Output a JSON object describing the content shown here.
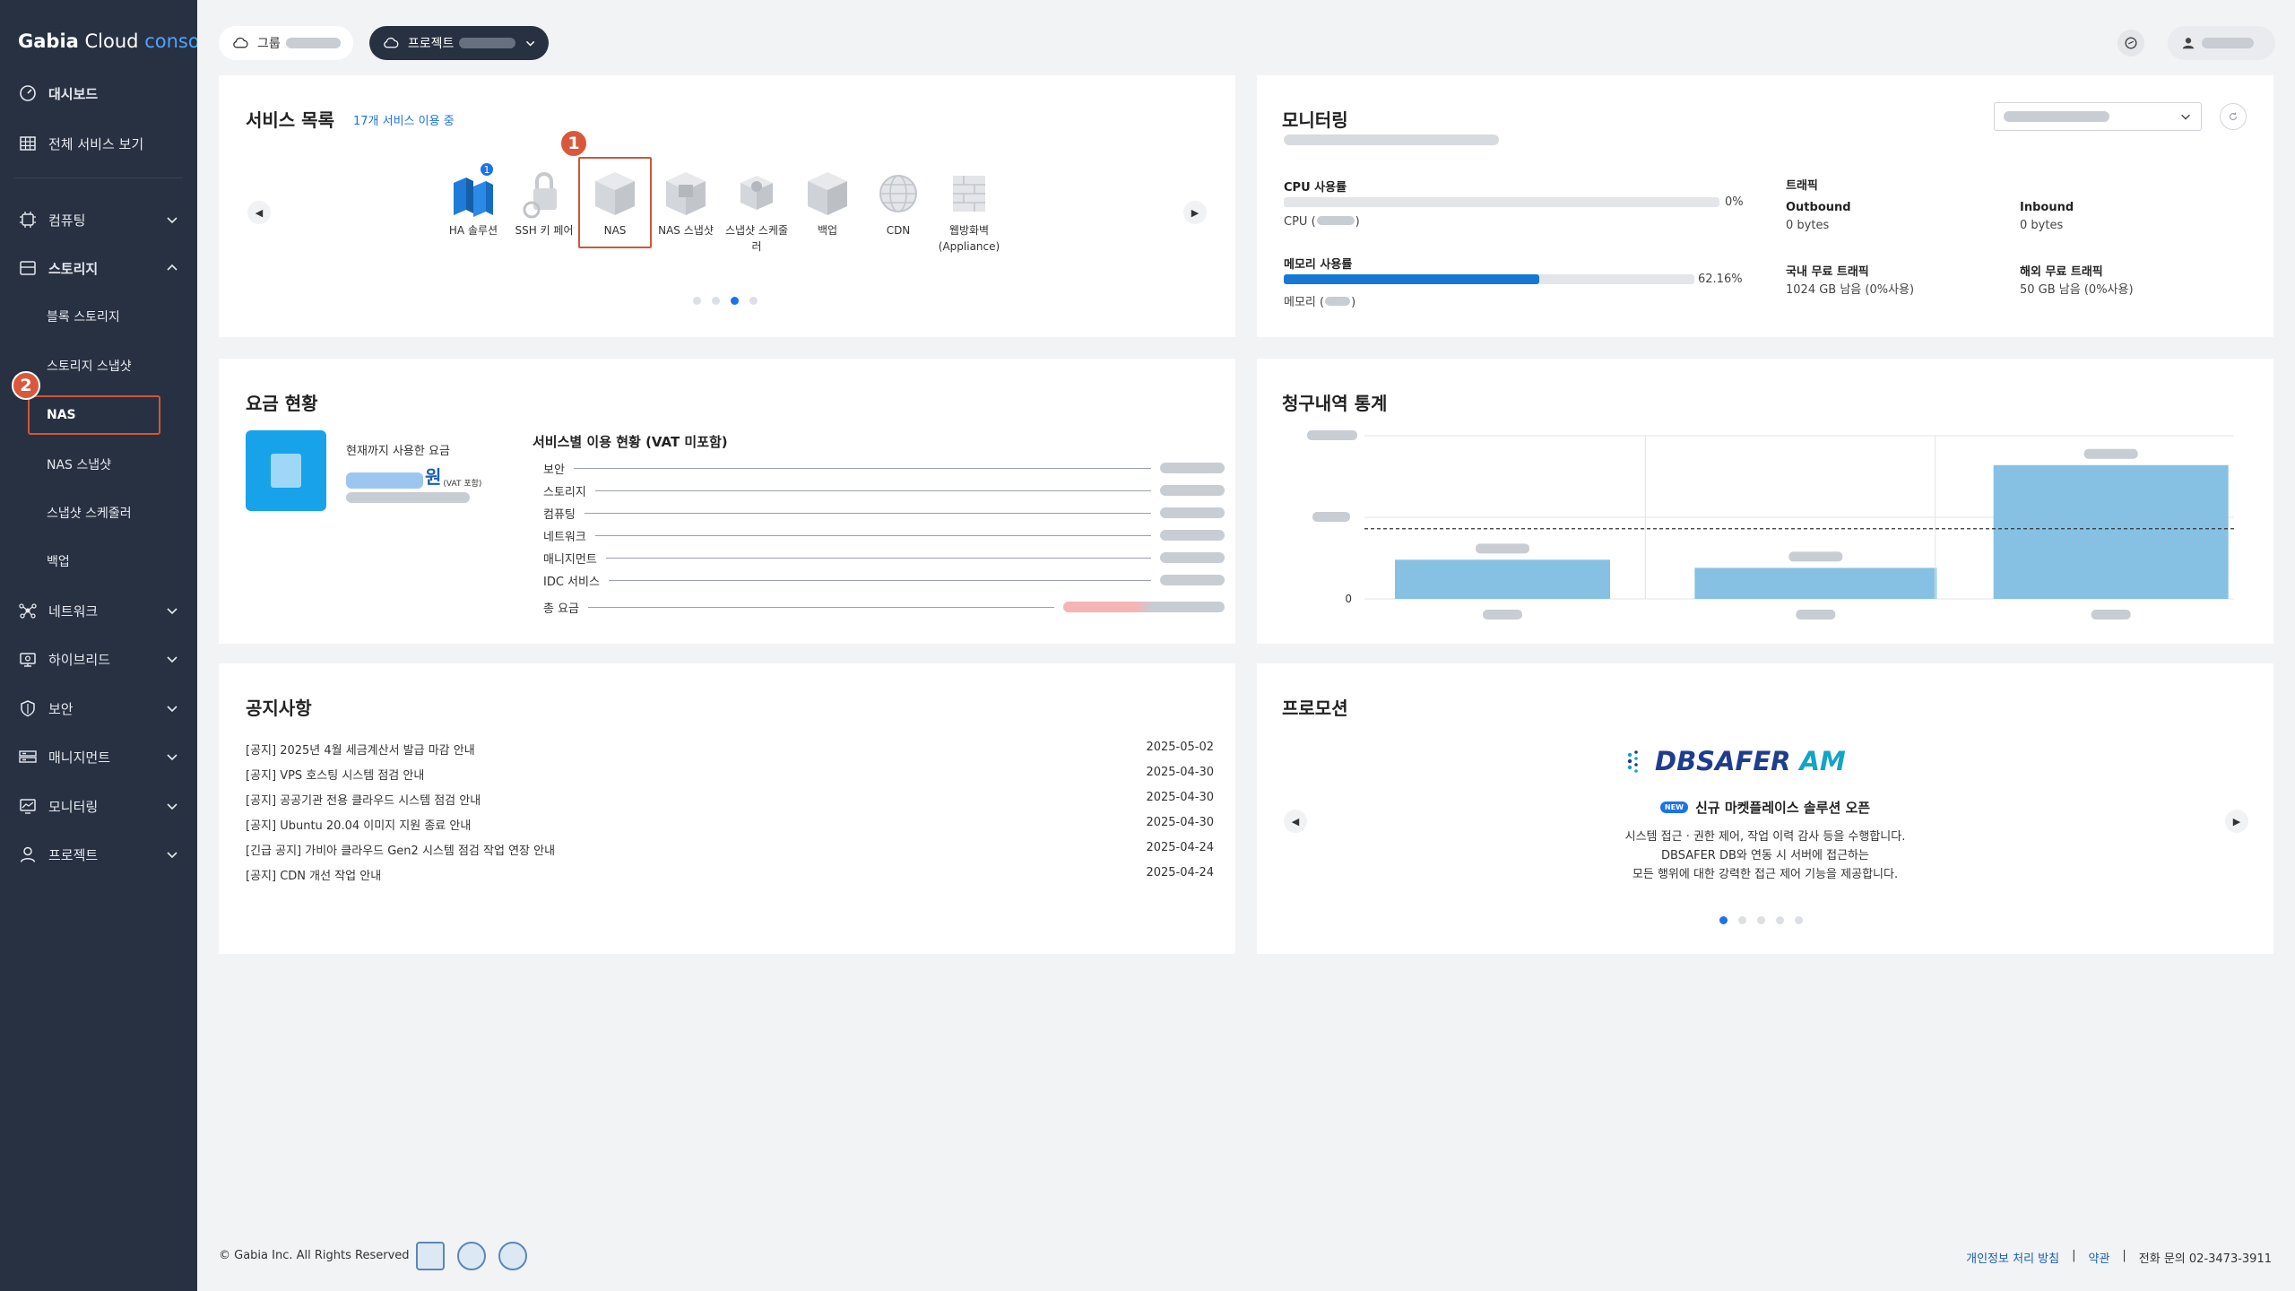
{
  "brand": {
    "name": "Gabia",
    "cloud": "Cloud",
    "console": "console"
  },
  "topbar": {
    "group_label": "그룹",
    "project_label": "프로젝트"
  },
  "sidebar": {
    "top_items": [
      {
        "label": "대시보드",
        "icon": "dashboard-icon"
      },
      {
        "label": "전체 서비스 보기",
        "icon": "grid-icon"
      }
    ],
    "sections": [
      {
        "label": "컴퓨팅",
        "icon": "cpu-icon",
        "expanded": false
      },
      {
        "label": "스토리지",
        "icon": "storage-icon",
        "expanded": true
      },
      {
        "label": "네트워크",
        "icon": "network-icon",
        "expanded": false
      },
      {
        "label": "하이브리드",
        "icon": "hybrid-icon",
        "expanded": false
      },
      {
        "label": "보안",
        "icon": "shield-icon",
        "expanded": false
      },
      {
        "label": "매니지먼트",
        "icon": "management-icon",
        "expanded": false
      },
      {
        "label": "모니터링",
        "icon": "monitor-icon",
        "expanded": false
      },
      {
        "label": "프로젝트",
        "icon": "user-icon",
        "expanded": false
      }
    ],
    "storage_sub": [
      "블록 스토리지",
      "스토리지 스냅샷",
      "NAS",
      "NAS 스냅샷",
      "스냅샷 스케줄러",
      "백업"
    ],
    "active_item": "NAS"
  },
  "markers": [
    "1",
    "2"
  ],
  "services": {
    "title": "서비스 목록",
    "count_text": "17개 서비스 이용 중",
    "items": [
      {
        "name": "HA 솔루션",
        "badge": "1"
      },
      {
        "name": "SSH 키 페어"
      },
      {
        "name": "NAS"
      },
      {
        "name": "NAS 스냅샷"
      },
      {
        "name": "스냅샷 스케줄러"
      },
      {
        "name": "백업"
      },
      {
        "name": "CDN"
      },
      {
        "name": "웹방화벽 (Appliance)"
      }
    ],
    "page_count": 4,
    "current_page": 3
  },
  "monitoring": {
    "title": "모니터링",
    "cpu_label": "CPU 사용률",
    "cpu_percent_text": "0%",
    "cpu_percent": 0,
    "cpu_caption": "CPU (",
    "cpu_caption_end": ")",
    "mem_label": "메모리 사용률",
    "mem_percent_text": "62.16%",
    "mem_percent": 62.16,
    "mem_caption": "메모리 (",
    "mem_caption_end": ")",
    "traffic_title": "트래픽",
    "outbound_label": "Outbound",
    "outbound_value": "0 bytes",
    "inbound_label": "Inbound",
    "inbound_value": "0 bytes",
    "domestic_label": "국내 무료 트래픽",
    "domestic_value": "1024 GB 남음 (0%사용)",
    "overseas_label": "해외 무료 트래픽",
    "overseas_value": "50 GB 남음 (0%사용)"
  },
  "billing": {
    "title": "요금 현황",
    "used_label": "현재까지 사용한 요금",
    "currency": "원",
    "vat_note": "(VAT 포함)",
    "breakdown_title": "서비스별 이용 현황 (VAT 미포함)",
    "rows": [
      "보안",
      "스토리지",
      "컴퓨팅",
      "네트워크",
      "매니지먼트",
      "IDC 서비스"
    ],
    "total_label": "총 요금"
  },
  "billing_stats": {
    "title": "청구내역 통계",
    "y_zero_label": "0"
  },
  "chart_data": {
    "type": "bar",
    "title": "청구내역 통계",
    "categories": [
      "",
      "",
      ""
    ],
    "values": [
      0.24,
      0.19,
      0.82
    ],
    "grid": true,
    "reference_line": 0.43
  },
  "notices": {
    "title": "공지사항",
    "items": [
      {
        "title": "[공지] 2025년 4월 세금계산서 발급 마감 안내",
        "date": "2025-05-02"
      },
      {
        "title": "[공지] VPS 호스팅 시스템 점검 안내",
        "date": "2025-04-30"
      },
      {
        "title": "[공지] 공공기관 전용 클라우드 시스템 점검 안내",
        "date": "2025-04-30"
      },
      {
        "title": "[공지] Ubuntu 20.04 이미지 지원 종료 안내",
        "date": "2025-04-30"
      },
      {
        "title": "[긴급 공지] 가비아 클라우드 Gen2 시스템 점검 작업 연장 안내",
        "date": "2025-04-24"
      },
      {
        "title": "[공지] CDN 개선 작업 안내",
        "date": "2025-04-24"
      }
    ]
  },
  "promotion": {
    "title": "프로모션",
    "logo_main": "DBSAFER",
    "logo_am": "AM",
    "new_badge": "NEW",
    "headline": "신규 마켓플레이스 솔루션 오픈",
    "lines": [
      "시스템 접근 · 권한 제어, 작업 이력 감사 등을 수행합니다.",
      "DBSAFER DB와 연동 시 서버에 접근하는",
      "모든 행위에 대한 강력한 접근 제어 기능을 제공합니다."
    ],
    "page_count": 5,
    "current_page": 1
  },
  "footer": {
    "copyright": "© Gabia Inc. All Rights Reserved",
    "privacy": "개인정보 처리 방침",
    "terms": "약관",
    "phone": "전화 문의 02-3473-3911",
    "separator": "|"
  },
  "colors": {
    "sidebar": "#283142",
    "accent": "#1a73e8",
    "marker": "#d9583b",
    "bar": "#86c1e3",
    "mem_bar": "#1478d4"
  }
}
